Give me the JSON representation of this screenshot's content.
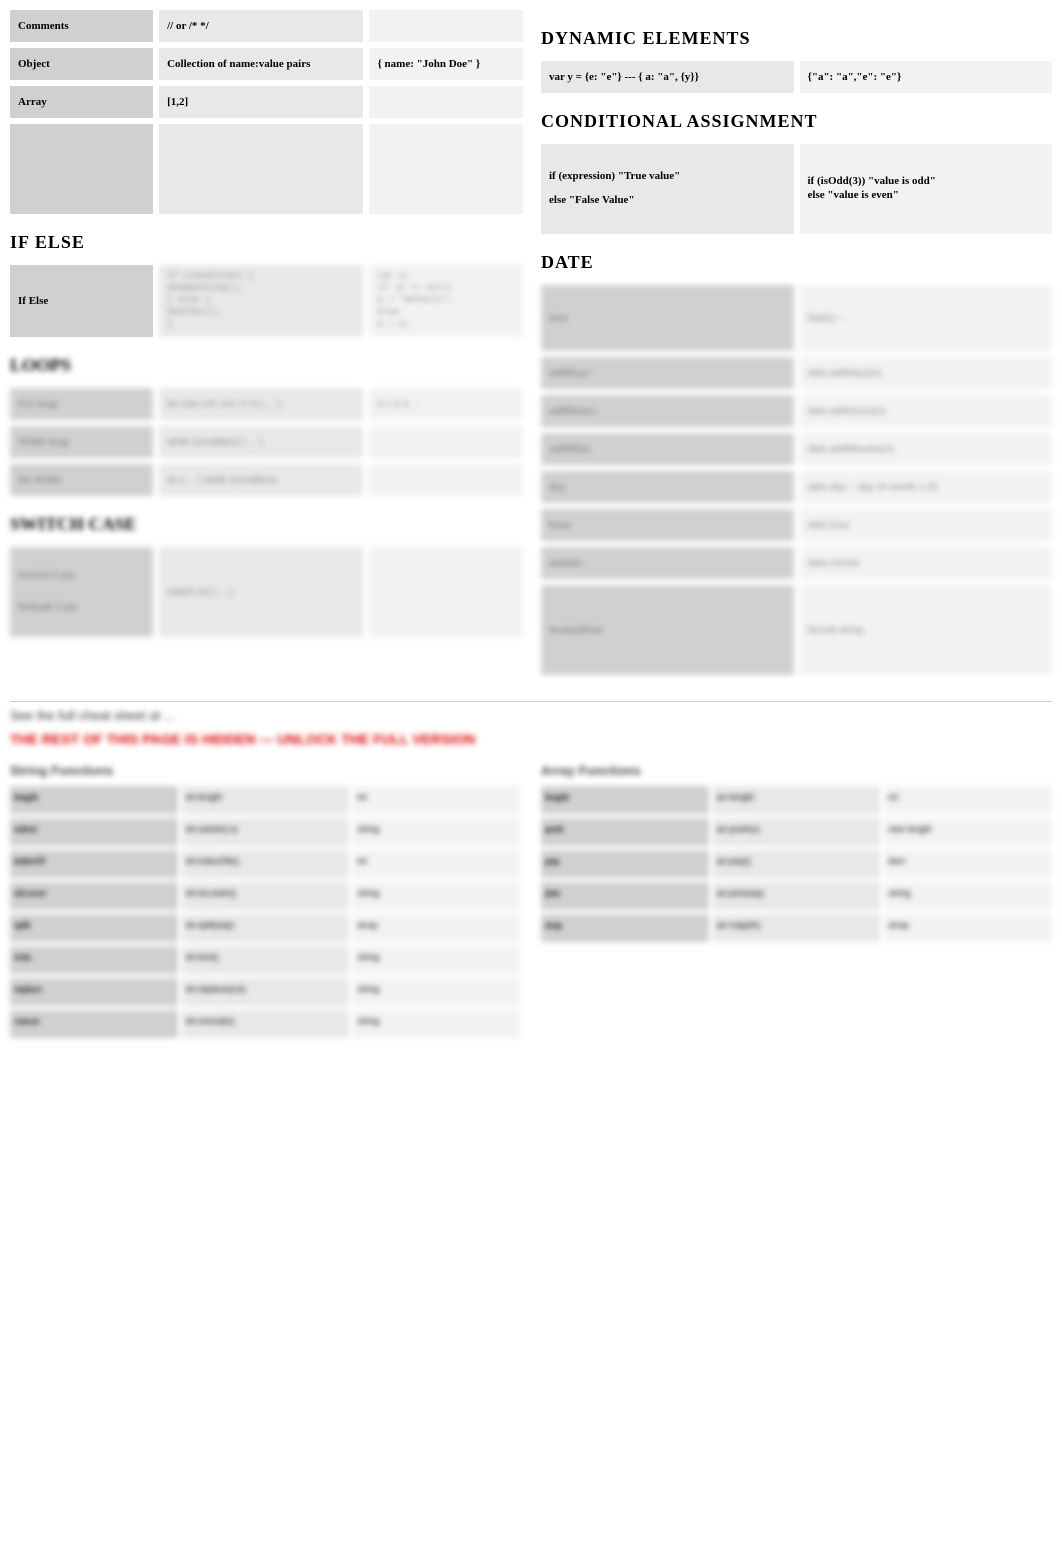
{
  "left": {
    "basics": [
      {
        "c1": "Comments",
        "c2": "// or /* */",
        "c3": ""
      },
      {
        "c1": "Object",
        "c2": "Collection of name:value pairs",
        "c3": "{  name: \"John Doe\" }"
      },
      {
        "c1": "Array",
        "c2": "[1,2]",
        "c3": ""
      },
      {
        "c1": "",
        "c2": "",
        "c3": ""
      }
    ],
    "ifelse_title": "IF ELSE",
    "ifelse": {
      "c1": "If Else",
      "c2": [
        "if (condition) {",
        "  doSomething();",
        "} else {",
        "  doOther();",
        "}"
      ],
      "c3": [
        "var a;",
        "if (a == null)",
        "  a = \"default\";",
        "else",
        "  a = a;"
      ]
    },
    "blur_section_1": "LOOPS",
    "blur_rows_a": [
      {
        "c1": "For loop",
        "c2": "for (var i=0; i<n; i++) { ... }",
        "c3": "0 1 2 3 ..."
      },
      {
        "c1": "While loop",
        "c2": "while (condition) { ... }",
        "c3": ""
      },
      {
        "c1": "Do While",
        "c2": "do { ... } while (condition)",
        "c3": ""
      }
    ],
    "blur_section_2": "SWITCH CASE",
    "blur_switch": {
      "c1a": "Switch Case",
      "c1b": "Default Case",
      "c2": "switch (x) { ... }",
      "c3": ""
    }
  },
  "right": {
    "dyn_title": "DYNAMIC ELEMENTS",
    "dyn": {
      "c1": "var y = {e: \"e\"} ---  { a: \"a\",  {y}}",
      "c2": "{\"a\": \"a\",\"e\": \"e\"}"
    },
    "cond_title": "CONDITIONAL ASSIGNMENT",
    "cond": {
      "c1a": "if (expression) \"True value\"",
      "c1b": "else \"False Value\"",
      "c2a": "if (isOdd(3)) \"value is odd\"",
      "c2b": "else \"value is even\""
    },
    "date_title": "DATE",
    "date_rows": [
      {
        "c1": "now",
        "c2": "Date() --",
        "tall": true
      },
      {
        "c1": "addDays",
        "c2": "date.addDays(n)"
      },
      {
        "c1": "addHours",
        "c2": "date.addHours(n)"
      },
      {
        "c1": "addMins",
        "c2": "date.addMinutes(n)"
      },
      {
        "c1": "day",
        "c2": "date.day  -- day of month 1-31"
      },
      {
        "c1": "hour",
        "c2": "date.hour"
      },
      {
        "c1": "minute",
        "c2": "date.minute"
      },
      {
        "c1": "formatDate",
        "c2": "format string",
        "tall": true
      }
    ]
  },
  "bottom": {
    "note1": "See the full cheat sheet at ...",
    "note2": "THE REST OF THIS PAGE IS HIDDEN — UNLOCK THE FULL VERSION",
    "sub1": "String Functions",
    "sub2": "Array Functions",
    "t1": [
      {
        "a": "length",
        "b": "str.length",
        "c": "int"
      },
      {
        "a": "substr",
        "b": "str.substr(i,n)",
        "c": "string"
      },
      {
        "a": "indexOf",
        "b": "str.indexOf(s)",
        "c": "int"
      },
      {
        "a": "toLower",
        "b": "str.toLower()",
        "c": "string"
      },
      {
        "a": "split",
        "b": "str.split(sep)",
        "c": "array"
      },
      {
        "a": "trim",
        "b": "str.trim()",
        "c": "string"
      },
      {
        "a": "replace",
        "b": "str.replace(a,b)",
        "c": "string"
      },
      {
        "a": "concat",
        "b": "str.concat(s)",
        "c": "string"
      }
    ],
    "t2": [
      {
        "a": "length",
        "b": "arr.length",
        "c": "int"
      },
      {
        "a": "push",
        "b": "arr.push(x)",
        "c": "new length"
      },
      {
        "a": "pop",
        "b": "arr.pop()",
        "c": "item"
      },
      {
        "a": "join",
        "b": "arr.join(sep)",
        "c": "string"
      },
      {
        "a": "map",
        "b": "arr.map(fn)",
        "c": "array"
      }
    ]
  }
}
